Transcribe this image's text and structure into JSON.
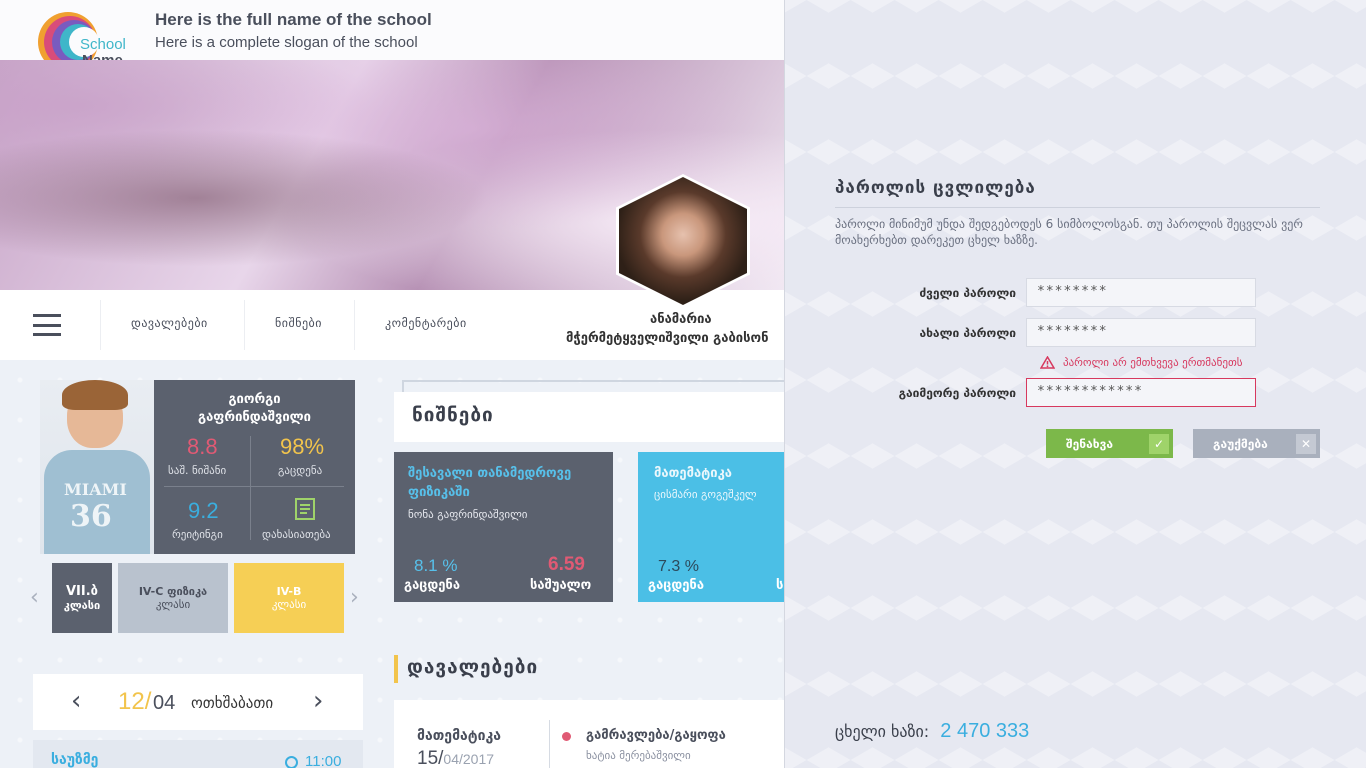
{
  "header": {
    "school_title": "Here is the full name of the school",
    "school_slogan": "Here is a complete slogan of the school",
    "logo_text_1": "School",
    "logo_text_2": "Name"
  },
  "nav": {
    "items": [
      "დავალებები",
      "ნიშნები",
      "კომენტარები"
    ]
  },
  "teacher": {
    "first_name": "ანამარია",
    "last_name": "მჭერმეტყველიშვილი გაბისონ"
  },
  "student": {
    "name_line1": "გიორგი",
    "name_line2": "გაფრინდაშვილი",
    "avg_grade": "8.8",
    "avg_grade_label": "საშ. ნიშანი",
    "attendance": "98%",
    "attendance_label": "გაცდენა",
    "rating": "9.2",
    "rating_label": "რეიტინგი",
    "profile_label": "დახასიათება",
    "shirt_line1": "MIAMI",
    "shirt_line2": "36"
  },
  "classes": [
    {
      "code": "VII.ბ",
      "label": "კლასი"
    },
    {
      "code": "IV-C ფიზიკა",
      "label": "კლასი"
    },
    {
      "code": "IV-B",
      "label": "კლასი"
    }
  ],
  "date": {
    "day": "12/",
    "month": "04",
    "weekday": "ოთხშაბათი"
  },
  "schedule_preview": {
    "subject": "საუზმე",
    "time": "11:00"
  },
  "grades": {
    "title": "ნიშნები",
    "cards": [
      {
        "subject": "შესავალი თანამედროვე ფიზიკაში",
        "teacher": "ნონა გაფრინდაშვილი",
        "absence_value": "8.1 %",
        "absence_label": "გაცდენა",
        "avg_value": "6.59",
        "avg_label": "საშუალო"
      },
      {
        "subject": "მათემატიკა",
        "teacher": "ცისმარი გოგეშკელ",
        "absence_value": "7.3 %",
        "absence_label": "გაცდენა",
        "avg_value": "",
        "avg_label": "ს"
      }
    ]
  },
  "tasks": {
    "title": "დავალებები",
    "first": {
      "subject": "მათემატიკა",
      "date_day": "15/",
      "date_rest": "04/2017",
      "task": "გამრავლება/გაყოფა",
      "author": "ხატია მერებაშვილი"
    }
  },
  "password_panel": {
    "title": "პაროლის ცვლილება",
    "description": "პაროლი მინიმუმ უნდა შედგებოდეს 6 სიმბოლოსგან. თუ პაროლის შეცვლას ვერ მოახერხებთ დარეკეთ ცხელ ხაზზე.",
    "old_label": "ძველი პაროლი",
    "old_value": "********",
    "new_label": "ახალი პაროლი",
    "new_value": "********",
    "error_message": "პაროლი არ ემთხვევა ერთმანეთს",
    "repeat_label": "გაიმეორე პაროლი",
    "repeat_value": "************",
    "save_label": "შენახვა",
    "cancel_label": "გაუქმება",
    "hotline_label": "ცხელი ხაზი:",
    "hotline_number": "2 470 333"
  },
  "colors": {
    "dark_card": "#5b616e",
    "accent_blue": "#3aaedf",
    "accent_yellow": "#f2c44c",
    "accent_red": "#e05a74",
    "save_green": "#7cb84a",
    "cancel_gray": "#a9b0bd"
  }
}
